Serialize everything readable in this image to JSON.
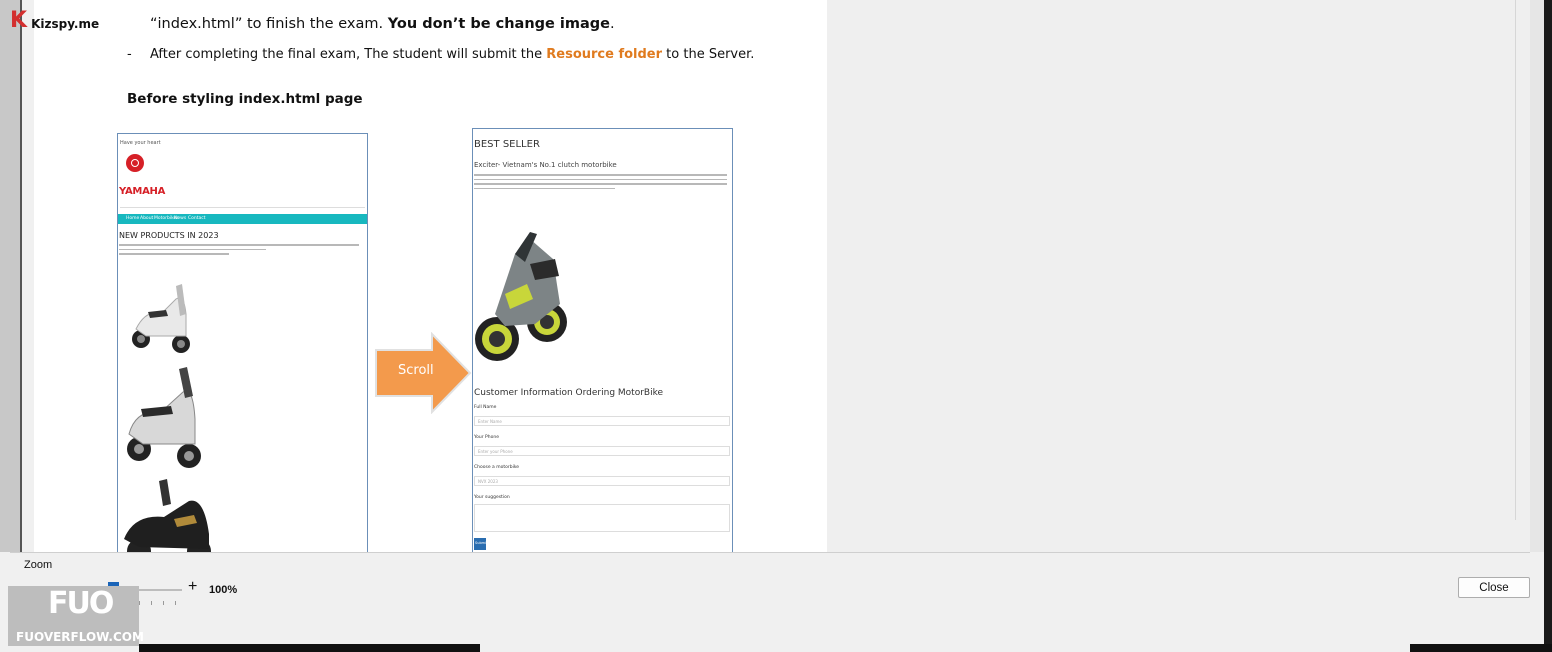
{
  "watermark_top": {
    "k": "K",
    "text": "Kizspy.me"
  },
  "document": {
    "line1_prefix": "“index.html”  to finish the exam. ",
    "line1_bold": "You don’t be change image",
    "line1_suffix": ".",
    "bullet_mark": "-",
    "line2_prefix": "After completing the final exam, The student will submit the ",
    "line2_highlight": "Resource folder",
    "line2_suffix": " to the Server.",
    "heading": "Before styling index.html page",
    "arrow_label": "Scroll"
  },
  "mock_left": {
    "top_text": "Have your heart",
    "brand": "YAMAHA",
    "nav": [
      "Home",
      "About",
      "Motorbikes",
      "News",
      "Contact"
    ],
    "heading": "NEW PRODUCTS IN 2023"
  },
  "mock_right": {
    "title": "BEST SELLER",
    "subtitle": "Exciter- Vietnam's No.1 clutch motorbike",
    "form_title": "Customer Information Ordering MotorBike",
    "fields": [
      {
        "label": "Full Name",
        "placeholder": "Enter Name"
      },
      {
        "label": "Your Phone",
        "placeholder": "Enter your Phone"
      },
      {
        "label": "Choose a motorbike",
        "placeholder": "NVX 2023"
      },
      {
        "label": "Your suggestion",
        "placeholder": ""
      }
    ],
    "submit": "Submit"
  },
  "zoom": {
    "label": "Zoom",
    "minus": "-",
    "plus": "+",
    "value": "100%",
    "level_percent": 100
  },
  "close_button": "Close",
  "watermark_bottom": {
    "mark": "FUO",
    "text": "FUOVERFLOW.COM"
  },
  "colors": {
    "accent_orange": "#e07b1f",
    "nav_teal": "#17b8bf",
    "slider_blue": "#1a64b8",
    "yamaha_red": "#d62027"
  }
}
